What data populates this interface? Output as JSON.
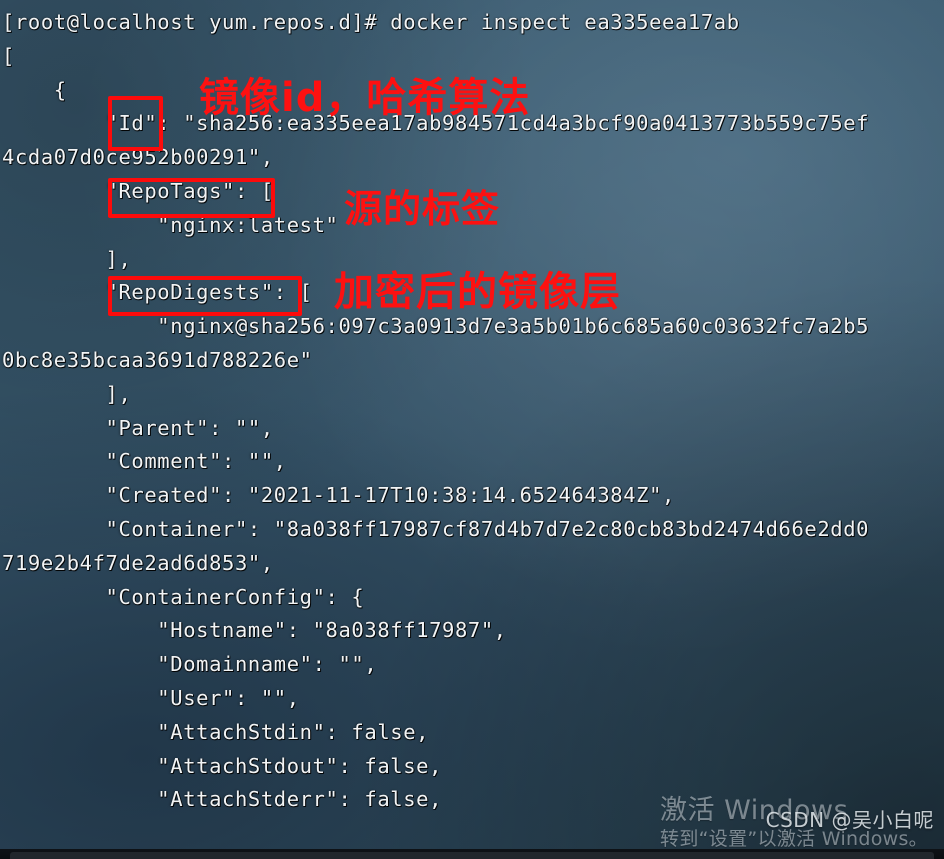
{
  "window": {
    "kind": "terminal-emulator",
    "shell_prompt": "[root@localhost yum.repos.d]#",
    "command": "docker inspect ea335eea17ab"
  },
  "terminal": {
    "prompt_line": "[root@localhost yum.repos.d]# docker inspect ea335eea17ab",
    "lines": [
      "[root@localhost yum.repos.d]# docker inspect ea335eea17ab",
      "[",
      "    {",
      "        \"Id\": \"sha256:ea335eea17ab984571cd4a3bcf90a0413773b559c75ef",
      "4cda07d0ce952b00291\",",
      "        \"RepoTags\": [",
      "            \"nginx:latest\"",
      "        ],",
      "        \"RepoDigests\": [",
      "            \"nginx@sha256:097c3a0913d7e3a5b01b6c685a60c03632fc7a2b5",
      "0bc8e35bcaa3691d788226e\"",
      "        ],",
      "        \"Parent\": \"\",",
      "        \"Comment\": \"\",",
      "        \"Created\": \"2021-11-17T10:38:14.652464384Z\",",
      "        \"Container\": \"8a038ff17987cf87d4b7d7e2c80cb83bd2474d66e2dd0",
      "719e2b4f7de2ad6d853\",",
      "        \"ContainerConfig\": {",
      "            \"Hostname\": \"8a038ff17987\",",
      "            \"Domainname\": \"\",",
      "            \"User\": \"\",",
      "            \"AttachStdin\": false,",
      "            \"AttachStdout\": false,",
      "            \"AttachStderr\": false,"
    ]
  },
  "inspect_fields": {
    "Id": "sha256:ea335eea17ab984571cd4a3bcf90a0413773b559c75ef4cda07d0ce952b00291",
    "RepoTags": [
      "nginx:latest"
    ],
    "RepoDigests": [
      "nginx@sha256:097c3a0913d7e3a5b01b6c685a60c03632fc7a2b50bc8e35bcaa3691d788226e"
    ],
    "Parent": "",
    "Comment": "",
    "Created": "2021-11-17T10:38:14.652464384Z",
    "Container": "8a038ff17987cf87d4b7d7e2c80cb83bd2474d66e2dd0719e2b4f7de2ad6d853",
    "ContainerConfig": {
      "Hostname": "8a038ff17987",
      "Domainname": "",
      "User": "",
      "AttachStdin": "false",
      "AttachStdout": "false",
      "AttachStderr": "false"
    }
  },
  "annotations": {
    "color": "#fd0b0b",
    "id_caption": "镜像id，哈希算法",
    "repotags_caption": "源的标签",
    "repodigests_caption": "加密后的镜像层"
  },
  "watermark": {
    "title": "激活 Windows",
    "subtitle": "转到“设置”以激活 Windows。"
  },
  "credit": {
    "text": "CSDN @吴小白呢"
  }
}
